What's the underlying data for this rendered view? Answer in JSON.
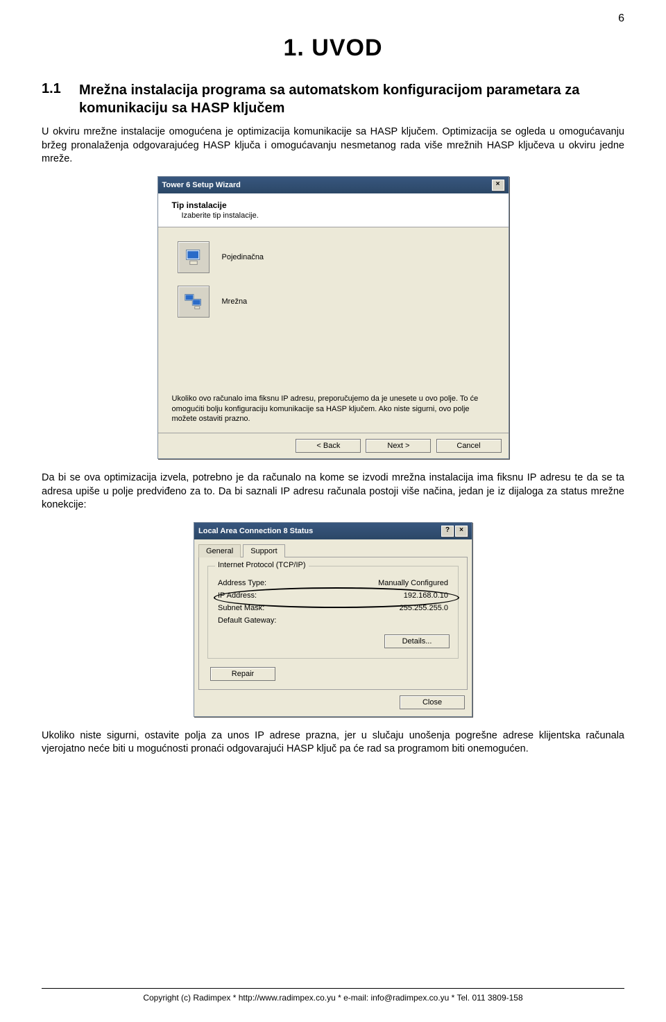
{
  "page_number": "6",
  "heading": "1. UVOD",
  "section": {
    "num": "1.1",
    "title": "Mrežna instalacija programa sa automatskom konfiguracijom parametara za komunikaciju sa HASP ključem"
  },
  "para1": "U okviru mrežne instalacije omogućena je optimizacija komunikacije sa HASP ključem. Optimizacija se ogleda u omogućavanju bržeg pronalaženja odgovarajućeg HASP ključa i omogućavanju nesmetanog rada više mrežnih HASP ključeva u okviru jedne mreže.",
  "wizard": {
    "title": "Tower 6 Setup Wizard",
    "close": "×",
    "header_title": "Tip instalacije",
    "header_sub": "Izaberite tip instalacije.",
    "option1": "Pojedinačna",
    "option2": "Mrežna",
    "note": "Ukoliko ovo računalo ima fiksnu IP adresu, preporučujemo da je unesete u ovo polje. To će omogućiti bolju konfiguraciju komunikacije sa HASP ključem. Ako niste sigurni, ovo polje možete ostaviti prazno.",
    "back": "< Back",
    "next": "Next >",
    "cancel": "Cancel"
  },
  "para2": "Da bi se ova optimizacija izvela, potrebno je da računalo na kome se izvodi mrežna instalacija ima fiksnu IP adresu te da se ta adresa upiše u polje predviđeno za to. Da bi saznali IP adresu računala postoji više načina, jedan je iz dijaloga za status mrežne konekcije:",
  "status": {
    "title": "Local Area Connection 8 Status",
    "help": "?",
    "close": "×",
    "tab_general": "General",
    "tab_support": "Support",
    "group_title": "Internet Protocol (TCP/IP)",
    "addr_type_label": "Address Type:",
    "addr_type_value": "Manually Configured",
    "ip_label": "IP Address:",
    "ip_value": "192.168.0.10",
    "subnet_label": "Subnet Mask:",
    "subnet_value": "255.255.255.0",
    "gateway_label": "Default Gateway:",
    "gateway_value": "",
    "details": "Details...",
    "repair": "Repair",
    "close_btn": "Close"
  },
  "para3": "Ukoliko niste sigurni, ostavite polja za unos IP adrese prazna, jer u slučaju unošenja pogrešne adrese klijentska računala vjerojatno neće biti u mogućnosti pronaći odgovarajući HASP ključ pa će rad sa programom biti onemogućen.",
  "footer": "Copyright (c) Radimpex * http://www.radimpex.co.yu * e-mail: info@radimpex.co.yu * Tel. 011 3809-158"
}
